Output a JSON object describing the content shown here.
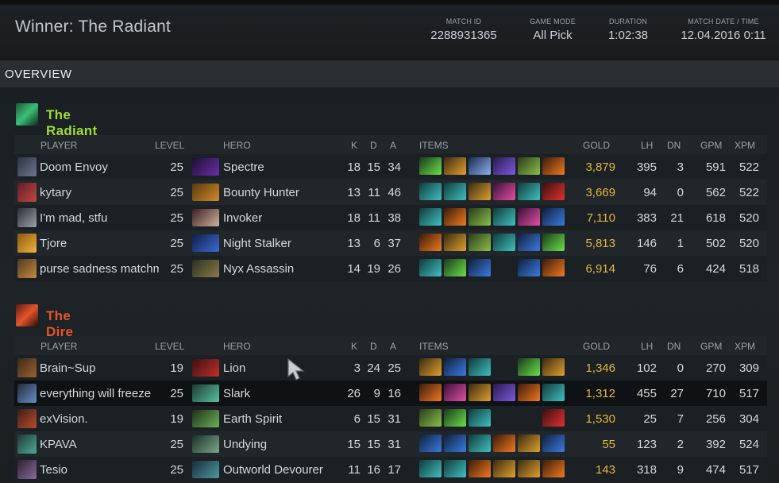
{
  "header": {
    "winner": "Winner: The Radiant",
    "match_id_label": "MATCH ID",
    "match_id": "2288931365",
    "game_mode_label": "GAME MODE",
    "game_mode": "All Pick",
    "duration_label": "DURATION",
    "duration": "1:02:38",
    "date_label": "MATCH DATE / TIME",
    "date": "12.04.2016 0:11"
  },
  "tab": "OVERVIEW",
  "columns": {
    "player": "PLAYER",
    "level": "LEVEL",
    "hero": "HERO",
    "k": "K",
    "d": "D",
    "a": "A",
    "items": "ITEMS",
    "gold": "GOLD",
    "lh": "LH",
    "dn": "DN",
    "gpm": "GPM",
    "xpm": "XPM"
  },
  "radiant": {
    "name": "The Radiant",
    "color": "#9fdc36",
    "rows": [
      {
        "player": "Doom Envoy",
        "level": "25",
        "hero": "Spectre",
        "k": "18",
        "d": "15",
        "a": "34",
        "gold": "3,879",
        "lh": "395",
        "dn": "3",
        "gpm": "591",
        "xpm": "522"
      },
      {
        "player": "kytary",
        "level": "25",
        "hero": "Bounty Hunter",
        "k": "13",
        "d": "11",
        "a": "46",
        "gold": "3,669",
        "lh": "94",
        "dn": "0",
        "gpm": "562",
        "xpm": "522"
      },
      {
        "player": "I'm mad, stfu",
        "level": "25",
        "hero": "Invoker",
        "k": "18",
        "d": "11",
        "a": "38",
        "gold": "7,110",
        "lh": "383",
        "dn": "21",
        "gpm": "618",
        "xpm": "520"
      },
      {
        "player": "Tjore",
        "level": "25",
        "hero": "Night Stalker",
        "k": "13",
        "d": "6",
        "a": "37",
        "gold": "5,813",
        "lh": "146",
        "dn": "1",
        "gpm": "502",
        "xpm": "520"
      },
      {
        "player": "purse sadness matchm",
        "level": "25",
        "hero": "Nyx Assassin",
        "k": "14",
        "d": "19",
        "a": "26",
        "gold": "6,914",
        "lh": "76",
        "dn": "6",
        "gpm": "424",
        "xpm": "518"
      }
    ]
  },
  "dire": {
    "name": "The Dire",
    "color": "#e5542a",
    "rows": [
      {
        "player": "Brain~Sup",
        "level": "19",
        "hero": "Lion",
        "k": "3",
        "d": "24",
        "a": "25",
        "gold": "1,346",
        "lh": "102",
        "dn": "0",
        "gpm": "270",
        "xpm": "309"
      },
      {
        "player": "everything will freeze",
        "level": "25",
        "hero": "Slark",
        "k": "26",
        "d": "9",
        "a": "16",
        "gold": "1,312",
        "lh": "455",
        "dn": "27",
        "gpm": "710",
        "xpm": "517"
      },
      {
        "player": "exVision.",
        "level": "19",
        "hero": "Earth Spirit",
        "k": "6",
        "d": "15",
        "a": "31",
        "gold": "1,530",
        "lh": "25",
        "dn": "7",
        "gpm": "256",
        "xpm": "304"
      },
      {
        "player": "KPAVA",
        "level": "25",
        "hero": "Undying",
        "k": "15",
        "d": "15",
        "a": "31",
        "gold": "55",
        "lh": "123",
        "dn": "2",
        "gpm": "392",
        "xpm": "524"
      },
      {
        "player": "Tesio",
        "level": "25",
        "hero": "Outworld Devourer",
        "k": "11",
        "d": "16",
        "a": "17",
        "gold": "143",
        "lh": "318",
        "dn": "9",
        "gpm": "474",
        "xpm": "517"
      }
    ]
  },
  "colors": {
    "gold_text": "#e3b43c",
    "radiant_title": "#9fdc36",
    "dire_title": "#e5542a"
  }
}
